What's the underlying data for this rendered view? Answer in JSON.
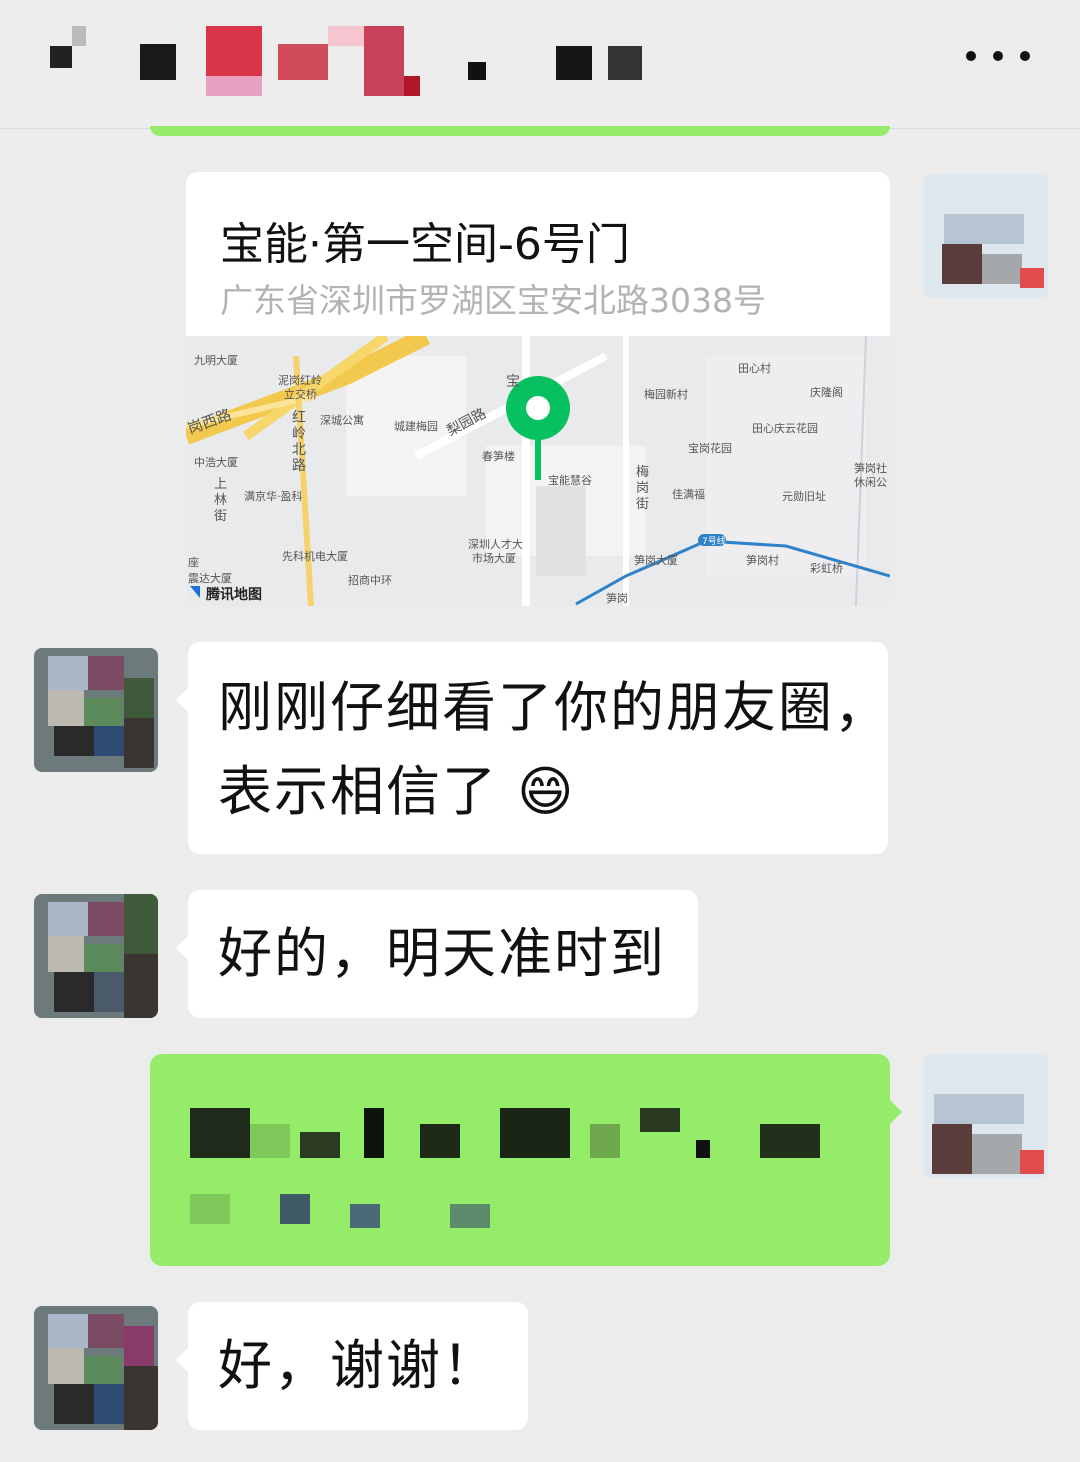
{
  "header": {
    "title_obscured": true,
    "more_icon": "more-dots-icon"
  },
  "messages": [
    {
      "type": "location",
      "side": "right",
      "name": "宝能·第一空间-6号门",
      "address": "广东省深圳市罗湖区宝安北路3038号",
      "map": {
        "brand": "腾讯地图",
        "labels": {
          "l1": "九明大厦",
          "l2": "泥岗红岭",
          "l3": "立交桥",
          "l4": "岗西路",
          "l5": "深城公寓",
          "l6": "城建梅园",
          "l7": "梨园路",
          "l8": "春笋楼",
          "l9": "宝能慧谷",
          "l10": "梅园新村",
          "l11": "田心村",
          "l12": "庆隆阁",
          "l13": "田心庆云花园",
          "l14": "宝岗花园",
          "l15": "笋岗社",
          "l16": "休闲公",
          "l17": "中浩大厦",
          "l18": "满京华·盈科",
          "l19": "佳满福",
          "l20": "元勋旧址",
          "l21": "先科机电大厦",
          "l22": "深圳人才大",
          "l23": "市场大厦",
          "l24": "招商中环",
          "l25": "笋岗大厦",
          "l26": "笋岗村",
          "l27": "彩虹桥",
          "l28": "笋岗",
          "l29": "座",
          "l30": "震达大厦",
          "l31": "7号线",
          "l32": "宝"
        },
        "vertical_labels": {
          "v1": [
            "红",
            "岭",
            "北",
            "路"
          ],
          "v2": [
            "上",
            "林",
            "街"
          ],
          "v3": [
            "梅",
            "岗",
            "街"
          ]
        }
      }
    },
    {
      "type": "text",
      "side": "left",
      "text_line1": "刚刚仔细看了你的朋友圈，",
      "text_line2": "表示相信了",
      "emoji": "😄"
    },
    {
      "type": "text",
      "side": "left",
      "text": "好的，明天准时到"
    },
    {
      "type": "text",
      "side": "right",
      "obscured": true
    },
    {
      "type": "text",
      "side": "left",
      "text": "好，谢谢！"
    }
  ],
  "colors": {
    "background": "#ececec",
    "bubble_self": "#95ec69",
    "bubble_other": "#ffffff",
    "map_pin": "#07c160",
    "address_text": "#b3b3b3"
  }
}
